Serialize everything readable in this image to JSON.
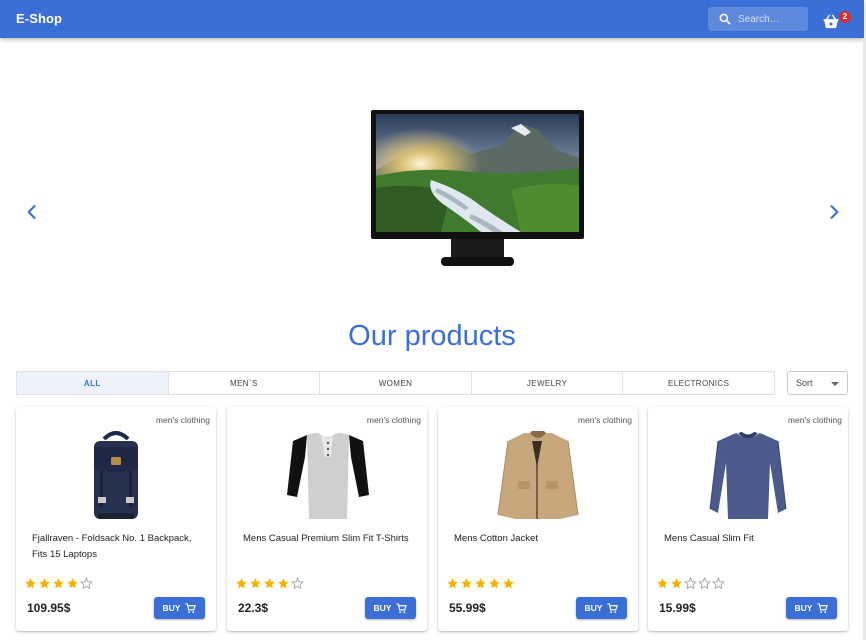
{
  "header": {
    "brand": "E-Shop",
    "search_placeholder": "Search…",
    "cart_count": "2",
    "bar_color": "#3c6fd6"
  },
  "carousel": {
    "prev_icon": "chevron-left-icon",
    "next_icon": "chevron-right-icon",
    "slide_image": "monitor-landscape-image"
  },
  "main": {
    "title": "Our products",
    "tabs": [
      {
        "label": "ALL",
        "active": true
      },
      {
        "label": "MEN`S",
        "active": false
      },
      {
        "label": "WOMEN",
        "active": false
      },
      {
        "label": "JEWELRY",
        "active": false
      },
      {
        "label": "ELECTRONICS",
        "active": false
      }
    ],
    "sort_label": "Sort"
  },
  "products": [
    {
      "category": "men's clothing",
      "name": "Fjallraven - Foldsack No. 1 Backpack, Fits 15 Laptops",
      "rating": 4,
      "price": "109.95$",
      "buy_label": "BUY",
      "image": "backpack-image"
    },
    {
      "category": "men's clothing",
      "name": "Mens Casual Premium Slim Fit T-Shirts",
      "rating": 4,
      "price": "22.3$",
      "buy_label": "BUY",
      "image": "raglan-tshirt-image"
    },
    {
      "category": "men's clothing",
      "name": "Mens Cotton Jacket",
      "rating": 5,
      "price": "55.99$",
      "buy_label": "BUY",
      "image": "cotton-jacket-image"
    },
    {
      "category": "men's clothing",
      "name": "Mens Casual Slim Fit",
      "rating": 2,
      "price": "15.99$",
      "buy_label": "BUY",
      "image": "slim-fit-shirt-image"
    }
  ],
  "colors": {
    "accent": "#3c6fd6",
    "star": "#f5b301",
    "badge": "#d32f2f"
  }
}
